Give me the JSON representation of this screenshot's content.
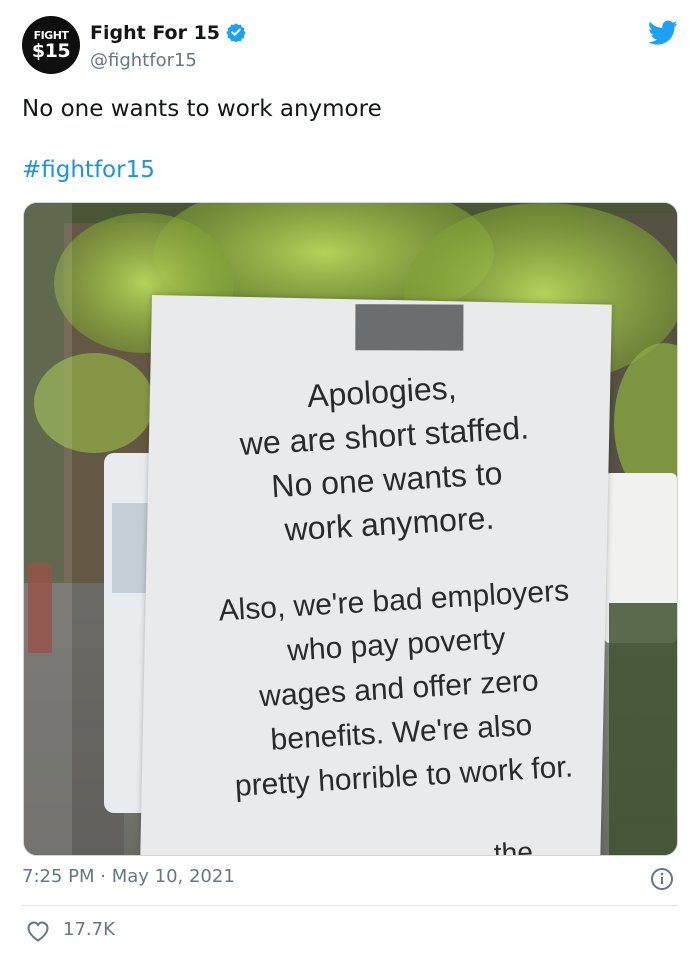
{
  "author": {
    "avatar_line1": "FIGHT",
    "avatar_line2": "$15",
    "name": "Fight For 15",
    "handle": "@fightfor15"
  },
  "tweet": {
    "text": "No one wants to work anymore",
    "hashtag": "#fightfor15"
  },
  "photo": {
    "sign_lines": [
      "Apologies,",
      "we are short staffed.",
      "No one wants to",
      "work anymore.",
      "Also, we're bad employers",
      "who pay poverty",
      "wages and offer zero",
      "benefits. We're also",
      "pretty horrible to work for."
    ],
    "cut_text": ". the"
  },
  "meta": {
    "timestamp": "7:25 PM · May 10, 2021",
    "likes": "17.7K"
  },
  "icons": {
    "verified": "verified-badge-icon",
    "brand": "twitter-bird-icon",
    "info": "info-icon",
    "like": "heart-icon"
  },
  "colors": {
    "link": "#1b95e0",
    "secondary_text": "#657786",
    "twitter_blue": "#1da1f2"
  }
}
